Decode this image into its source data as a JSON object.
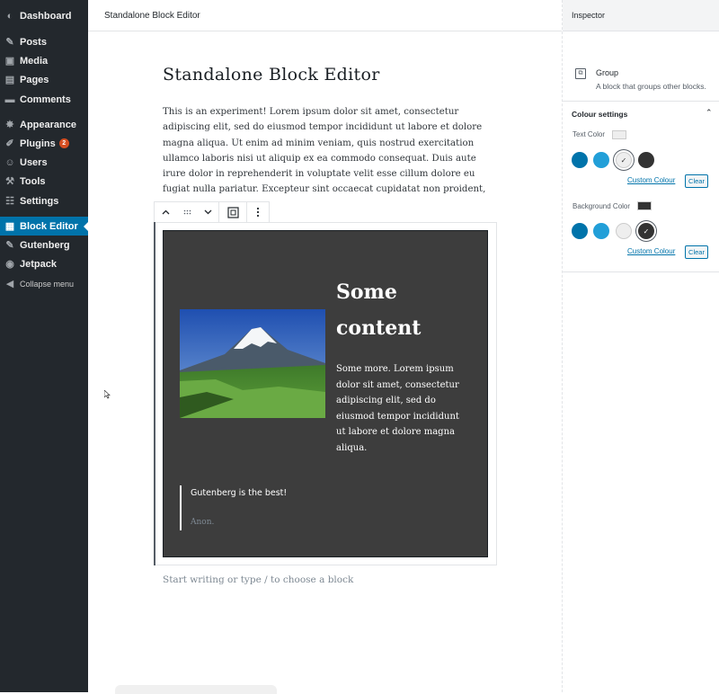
{
  "admin_menu": [
    {
      "name": "dashboard",
      "label": "Dashboard",
      "icon": "dashboard-icon",
      "glyph": "◐"
    },
    {
      "name": "posts",
      "label": "Posts",
      "icon": "pin-icon",
      "glyph": "✎"
    },
    {
      "name": "media",
      "label": "Media",
      "icon": "media-icon",
      "glyph": "▣"
    },
    {
      "name": "pages",
      "label": "Pages",
      "icon": "pages-icon",
      "glyph": "▤"
    },
    {
      "name": "comments",
      "label": "Comments",
      "icon": "comments-icon",
      "glyph": "▬"
    },
    {
      "name": "appearance",
      "label": "Appearance",
      "icon": "brush-icon",
      "glyph": "✸"
    },
    {
      "name": "plugins",
      "label": "Plugins",
      "icon": "plug-icon",
      "glyph": "✐",
      "badge": "2"
    },
    {
      "name": "users",
      "label": "Users",
      "icon": "users-icon",
      "glyph": "☺"
    },
    {
      "name": "tools",
      "label": "Tools",
      "icon": "wrench-icon",
      "glyph": "⚒"
    },
    {
      "name": "settings",
      "label": "Settings",
      "icon": "settings-icon",
      "glyph": "☷"
    },
    {
      "name": "block-editor",
      "label": "Block Editor",
      "icon": "block-editor-icon",
      "glyph": "▦",
      "active": true
    },
    {
      "name": "gutenberg",
      "label": "Gutenberg",
      "icon": "gutenberg-icon",
      "glyph": "✎"
    },
    {
      "name": "jetpack",
      "label": "Jetpack",
      "icon": "jetpack-icon",
      "glyph": "◉"
    },
    {
      "name": "collapse",
      "label": "Collapse menu",
      "icon": "collapse-icon",
      "glyph": "◀",
      "small": true
    }
  ],
  "header": {
    "title": "Standalone Block Editor"
  },
  "editor": {
    "post_title": "Standalone Block Editor",
    "paragraph": "This is an experiment! Lorem ipsum dolor sit amet, consectetur adipiscing elit, sed do eiusmod tempor incididunt ut labore et dolore magna aliqua. Ut enim ad minim veniam, quis nostrud exercitation ullamco laboris nisi ut aliquip ex ea commodo consequat. Duis aute irure dolor in reprehenderit in voluptate velit esse cillum dolore eu fugiat nulla pariatur. Excepteur sint occaecat cupidatat non proident, sunt in culpa qui officia deserunt mollit",
    "group": {
      "heading": "Some content",
      "text": "Some more. Lorem ipsum dolor sit amet, consectetur adipiscing elit, sed do eiusmod tempor incididunt ut labore et dolore magna aliqua.",
      "quote": "Gutenberg is the best!",
      "cite": "Anon."
    },
    "appender_placeholder": "Start writing or type / to choose a block"
  },
  "toolbar": {
    "move_up_icon": "chevron-up-icon",
    "drag_icon": "drag-handle-icon",
    "move_down_icon": "chevron-down-icon",
    "block_type_icon": "group-icon",
    "more_icon": "more-vertical-icon"
  },
  "inspector": {
    "title": "Inspector",
    "block_name": "Group",
    "block_desc": "A block that groups other blocks.",
    "colour_panel_title": "Colour settings",
    "text_color_label": "Text Color",
    "background_color_label": "Background Color",
    "custom_colour_label": "Custom Colour",
    "clear_label": "Clear",
    "palette": [
      "#0073aa",
      "#229fd8",
      "#eeeeee",
      "#333333"
    ],
    "text_color_value": "#eeeeee",
    "background_color_value": "#333333"
  }
}
